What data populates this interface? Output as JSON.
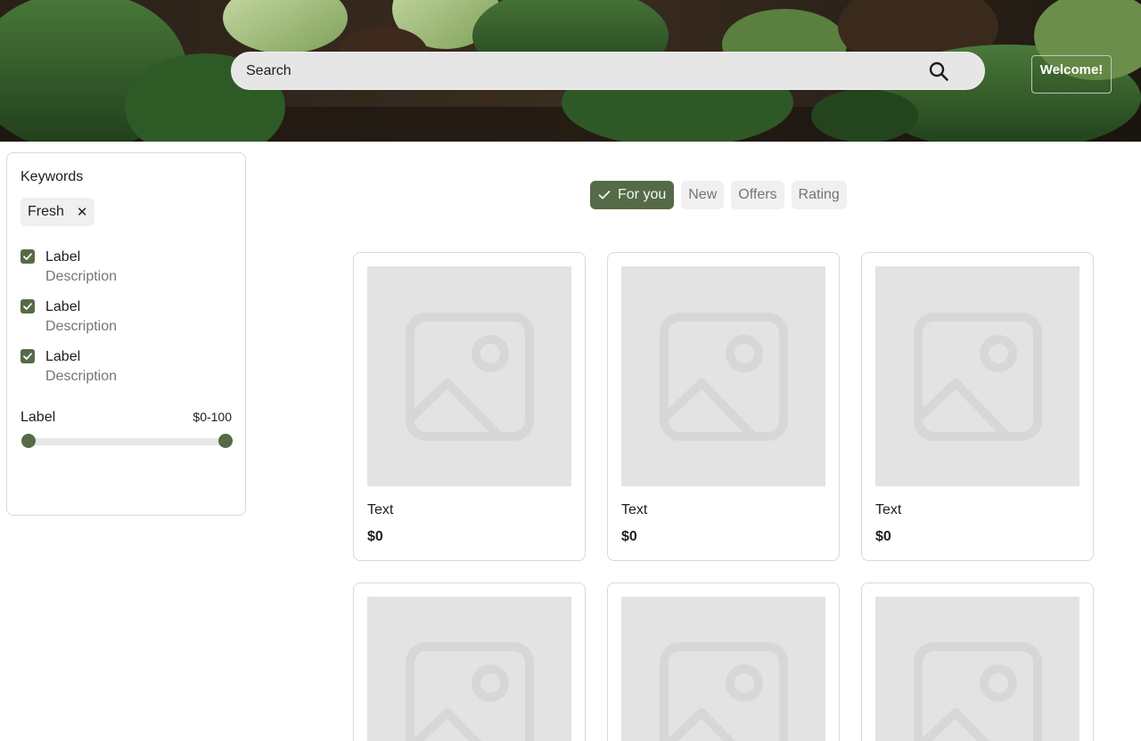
{
  "header": {
    "search": {
      "placeholder": "Search"
    },
    "welcome_label": "Welcome!"
  },
  "filters": {
    "keywords_title": "Keywords",
    "tags": [
      {
        "label": "Fresh"
      }
    ],
    "checkboxes": [
      {
        "label": "Label",
        "description": "Description",
        "checked": true
      },
      {
        "label": "Label",
        "description": "Description",
        "checked": true
      },
      {
        "label": "Label",
        "description": "Description",
        "checked": true
      }
    ],
    "range": {
      "label": "Label",
      "value_text": "$0-100",
      "min": 0,
      "max": 100
    }
  },
  "chips": [
    {
      "label": "For you",
      "active": true
    },
    {
      "label": "New",
      "active": false
    },
    {
      "label": "Offers",
      "active": false
    },
    {
      "label": "Rating",
      "active": false
    }
  ],
  "products": [
    {
      "title": "Text",
      "price": "$0"
    },
    {
      "title": "Text",
      "price": "$0"
    },
    {
      "title": "Text",
      "price": "$0"
    },
    {
      "title": "",
      "price": ""
    },
    {
      "title": "",
      "price": ""
    },
    {
      "title": "",
      "price": ""
    }
  ],
  "colors": {
    "accent": "#556b47",
    "chip_bg": "#f0f0f0",
    "placeholder_bg": "#e3e3e3",
    "border": "#d9d9d9"
  },
  "icons": {
    "search": "search-icon",
    "close": "close-icon",
    "check": "check-icon",
    "image_placeholder": "image-placeholder-icon"
  }
}
